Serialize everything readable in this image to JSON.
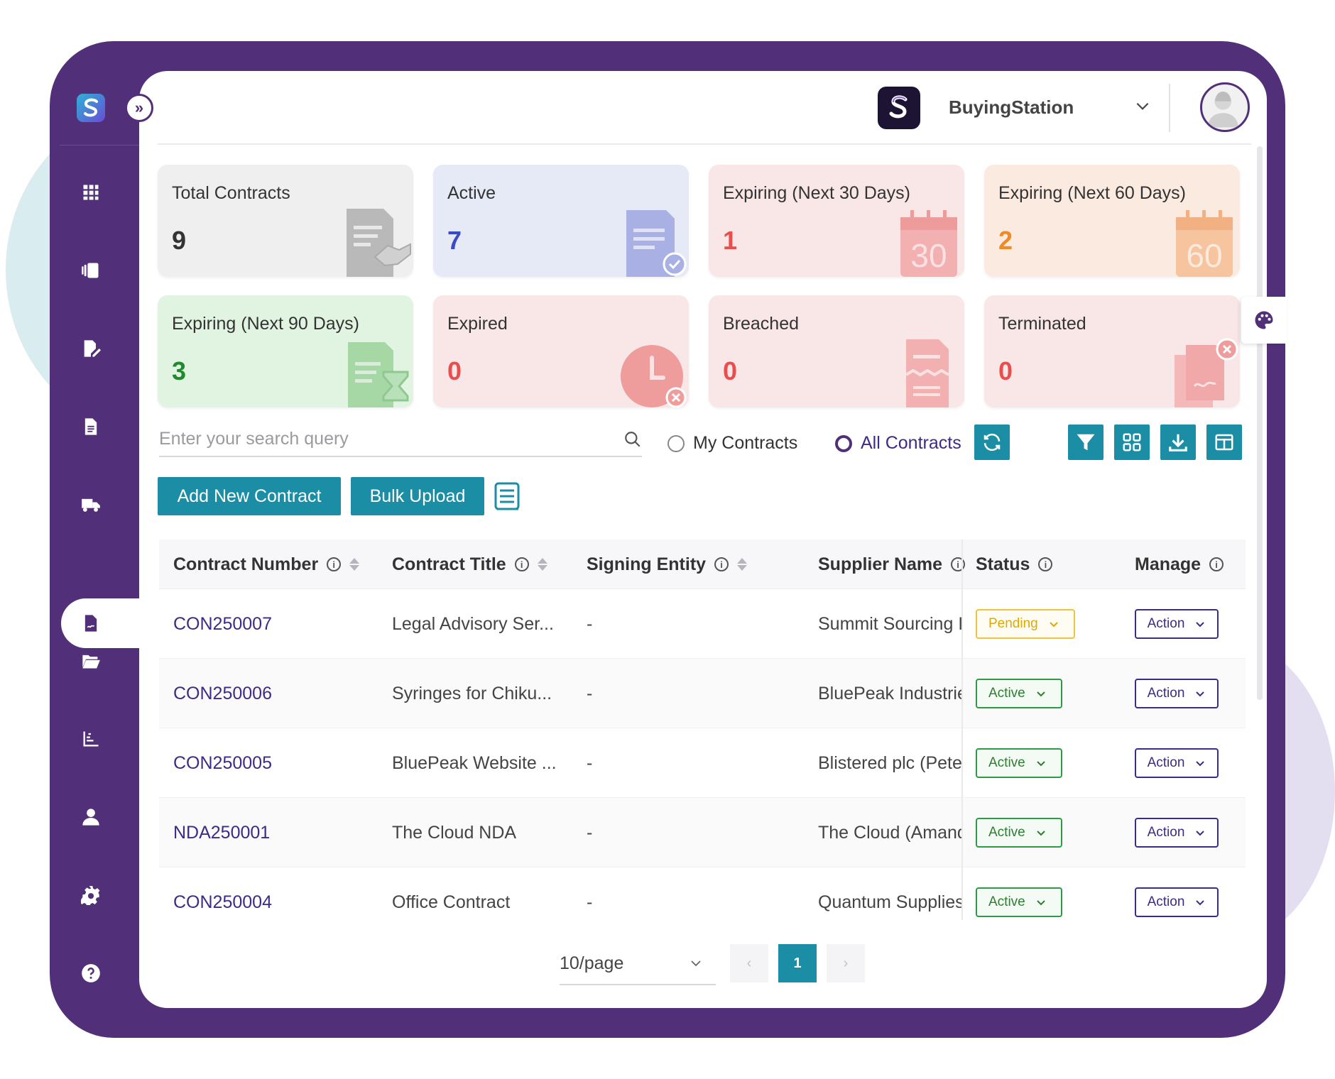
{
  "org": {
    "name": "BuyingStation"
  },
  "cards": [
    {
      "label": "Total Contracts",
      "value": "9",
      "icon": "contract-handshake-icon"
    },
    {
      "label": "Active",
      "value": "7",
      "icon": "document-check-icon"
    },
    {
      "label": "Expiring (Next 30 Days)",
      "value": "1",
      "icon": "calendar-30-icon",
      "icon_text": "30"
    },
    {
      "label": "Expiring (Next 60 Days)",
      "value": "2",
      "icon": "calendar-60-icon",
      "icon_text": "60"
    },
    {
      "label": "Expiring (Next 90 Days)",
      "value": "3",
      "icon": "document-hourglass-icon"
    },
    {
      "label": "Expired",
      "value": "0",
      "icon": "clock-x-icon"
    },
    {
      "label": "Breached",
      "value": "0",
      "icon": "torn-document-icon"
    },
    {
      "label": "Terminated",
      "value": "0",
      "icon": "document-x-icon"
    }
  ],
  "colors": {
    "frame": "#523079",
    "accent": "#1b8ea6",
    "total": "#333333",
    "active": "#3b4cc0",
    "red": "#e94e4e",
    "orange": "#f08a24",
    "green": "#1f8a2e"
  },
  "search": {
    "placeholder": "Enter your search query"
  },
  "filters": {
    "my_contracts": "My Contracts",
    "all_contracts": "All Contracts",
    "selected": "All Contracts"
  },
  "buttons": {
    "add_new": "Add New Contract",
    "bulk_upload": "Bulk Upload"
  },
  "table": {
    "columns": [
      "Contract Number",
      "Contract Title",
      "Signing Entity",
      "Supplier Name",
      "Status",
      "Manage"
    ],
    "rows": [
      {
        "number": "CON250007",
        "title": "Legal Advisory Ser...",
        "entity": "-",
        "supplier": "Summit Sourcing I...",
        "status": "Pending",
        "action": "Action"
      },
      {
        "number": "CON250006",
        "title": "Syringes for Chiku...",
        "entity": "-",
        "supplier": "BluePeak Industrie...",
        "status": "Active",
        "action": "Action"
      },
      {
        "number": "CON250005",
        "title": "BluePeak Website ...",
        "entity": "-",
        "supplier": "Blistered plc (Peter...",
        "status": "Active",
        "action": "Action"
      },
      {
        "number": "NDA250001",
        "title": "The Cloud NDA",
        "entity": "-",
        "supplier": "The Cloud (Amand...",
        "status": "Active",
        "action": "Action"
      },
      {
        "number": "CON250004",
        "title": "Office Contract",
        "entity": "-",
        "supplier": "Quantum Supplies...",
        "status": "Active",
        "action": "Action"
      }
    ]
  },
  "pagination": {
    "page_size": "10/page",
    "current_page": "1",
    "prev": "‹",
    "next": "›"
  }
}
